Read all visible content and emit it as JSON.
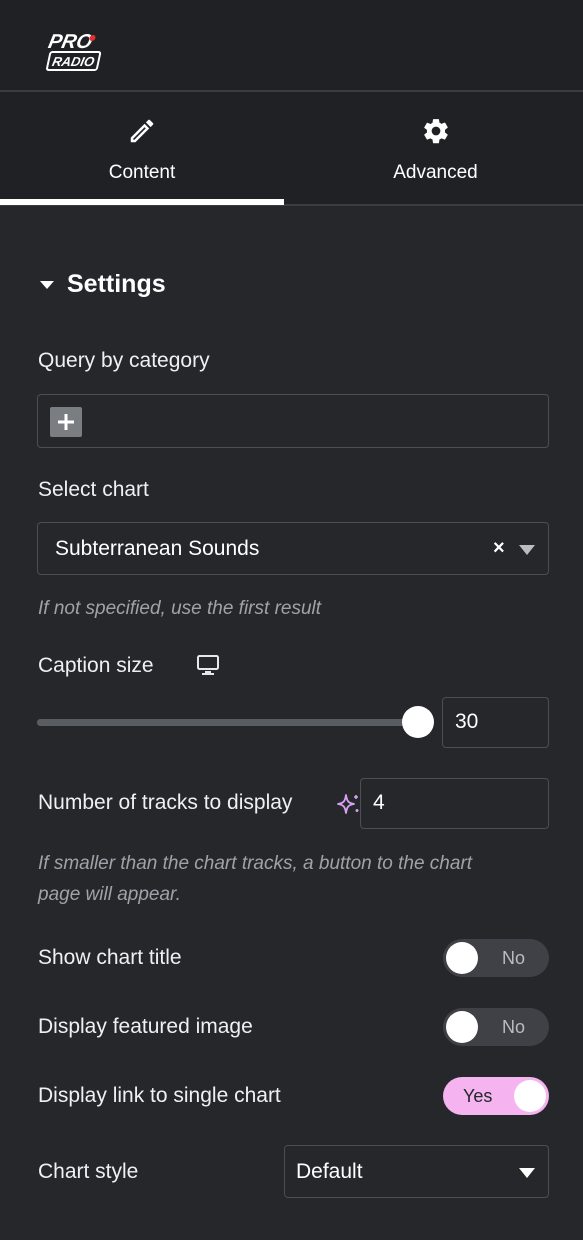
{
  "header": {
    "logo_line1": "PRO",
    "logo_line2": "RADIO"
  },
  "tabs": [
    {
      "label": "Content",
      "icon": "pencil-icon",
      "active": true
    },
    {
      "label": "Advanced",
      "icon": "gear-icon",
      "active": false
    }
  ],
  "section": {
    "title": "Settings",
    "icon": "caret-down-icon"
  },
  "query": {
    "label": "Query by category",
    "add_icon": "plus-icon"
  },
  "select_chart": {
    "label": "Select chart",
    "value": "Subterranean Sounds",
    "clear": "×",
    "hint": "If not specified, use the first result"
  },
  "caption_size": {
    "label": "Caption size",
    "device_icon": "desktop-icon",
    "value": "30",
    "slider_fraction": 1.0
  },
  "tracks": {
    "label": "Number of tracks to display",
    "ai_icon": "sparkle-icon",
    "value": "4",
    "hint_line1": "If smaller than the chart tracks, a button to the chart",
    "hint_line2": "page will appear."
  },
  "toggles": [
    {
      "label": "Show chart title",
      "state": "No",
      "on": false
    },
    {
      "label": "Display featured image",
      "state": "No",
      "on": false
    },
    {
      "label": "Display link to single chart",
      "state": "Yes",
      "on": true
    }
  ],
  "chart_style": {
    "label": "Chart style",
    "value": "Default"
  },
  "colors": {
    "panel_bg": "#26272b",
    "header_bg": "#1f2124",
    "accent_toggle": "#f5b4f0",
    "sparkle": "#d9a0f5"
  }
}
